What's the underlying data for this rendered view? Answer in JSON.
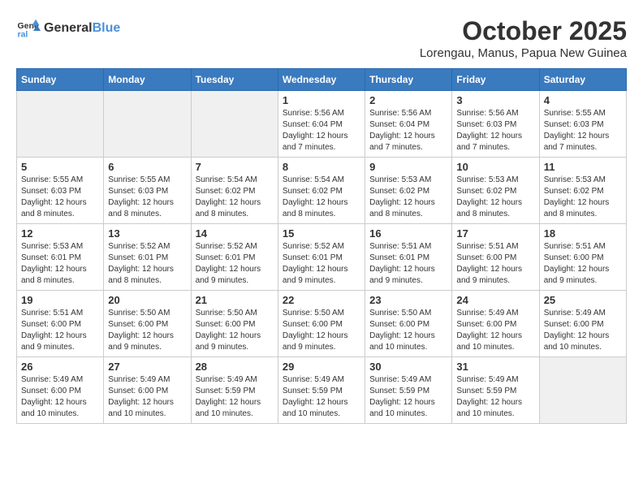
{
  "header": {
    "logo_line1": "General",
    "logo_line2": "Blue",
    "month_title": "October 2025",
    "subtitle": "Lorengau, Manus, Papua New Guinea"
  },
  "days_of_week": [
    "Sunday",
    "Monday",
    "Tuesday",
    "Wednesday",
    "Thursday",
    "Friday",
    "Saturday"
  ],
  "weeks": [
    [
      {
        "day": "",
        "info": ""
      },
      {
        "day": "",
        "info": ""
      },
      {
        "day": "",
        "info": ""
      },
      {
        "day": "1",
        "info": "Sunrise: 5:56 AM\nSunset: 6:04 PM\nDaylight: 12 hours and 7 minutes."
      },
      {
        "day": "2",
        "info": "Sunrise: 5:56 AM\nSunset: 6:04 PM\nDaylight: 12 hours and 7 minutes."
      },
      {
        "day": "3",
        "info": "Sunrise: 5:56 AM\nSunset: 6:03 PM\nDaylight: 12 hours and 7 minutes."
      },
      {
        "day": "4",
        "info": "Sunrise: 5:55 AM\nSunset: 6:03 PM\nDaylight: 12 hours and 7 minutes."
      }
    ],
    [
      {
        "day": "5",
        "info": "Sunrise: 5:55 AM\nSunset: 6:03 PM\nDaylight: 12 hours and 8 minutes."
      },
      {
        "day": "6",
        "info": "Sunrise: 5:55 AM\nSunset: 6:03 PM\nDaylight: 12 hours and 8 minutes."
      },
      {
        "day": "7",
        "info": "Sunrise: 5:54 AM\nSunset: 6:02 PM\nDaylight: 12 hours and 8 minutes."
      },
      {
        "day": "8",
        "info": "Sunrise: 5:54 AM\nSunset: 6:02 PM\nDaylight: 12 hours and 8 minutes."
      },
      {
        "day": "9",
        "info": "Sunrise: 5:53 AM\nSunset: 6:02 PM\nDaylight: 12 hours and 8 minutes."
      },
      {
        "day": "10",
        "info": "Sunrise: 5:53 AM\nSunset: 6:02 PM\nDaylight: 12 hours and 8 minutes."
      },
      {
        "day": "11",
        "info": "Sunrise: 5:53 AM\nSunset: 6:02 PM\nDaylight: 12 hours and 8 minutes."
      }
    ],
    [
      {
        "day": "12",
        "info": "Sunrise: 5:53 AM\nSunset: 6:01 PM\nDaylight: 12 hours and 8 minutes."
      },
      {
        "day": "13",
        "info": "Sunrise: 5:52 AM\nSunset: 6:01 PM\nDaylight: 12 hours and 8 minutes."
      },
      {
        "day": "14",
        "info": "Sunrise: 5:52 AM\nSunset: 6:01 PM\nDaylight: 12 hours and 9 minutes."
      },
      {
        "day": "15",
        "info": "Sunrise: 5:52 AM\nSunset: 6:01 PM\nDaylight: 12 hours and 9 minutes."
      },
      {
        "day": "16",
        "info": "Sunrise: 5:51 AM\nSunset: 6:01 PM\nDaylight: 12 hours and 9 minutes."
      },
      {
        "day": "17",
        "info": "Sunrise: 5:51 AM\nSunset: 6:00 PM\nDaylight: 12 hours and 9 minutes."
      },
      {
        "day": "18",
        "info": "Sunrise: 5:51 AM\nSunset: 6:00 PM\nDaylight: 12 hours and 9 minutes."
      }
    ],
    [
      {
        "day": "19",
        "info": "Sunrise: 5:51 AM\nSunset: 6:00 PM\nDaylight: 12 hours and 9 minutes."
      },
      {
        "day": "20",
        "info": "Sunrise: 5:50 AM\nSunset: 6:00 PM\nDaylight: 12 hours and 9 minutes."
      },
      {
        "day": "21",
        "info": "Sunrise: 5:50 AM\nSunset: 6:00 PM\nDaylight: 12 hours and 9 minutes."
      },
      {
        "day": "22",
        "info": "Sunrise: 5:50 AM\nSunset: 6:00 PM\nDaylight: 12 hours and 9 minutes."
      },
      {
        "day": "23",
        "info": "Sunrise: 5:50 AM\nSunset: 6:00 PM\nDaylight: 12 hours and 10 minutes."
      },
      {
        "day": "24",
        "info": "Sunrise: 5:49 AM\nSunset: 6:00 PM\nDaylight: 12 hours and 10 minutes."
      },
      {
        "day": "25",
        "info": "Sunrise: 5:49 AM\nSunset: 6:00 PM\nDaylight: 12 hours and 10 minutes."
      }
    ],
    [
      {
        "day": "26",
        "info": "Sunrise: 5:49 AM\nSunset: 6:00 PM\nDaylight: 12 hours and 10 minutes."
      },
      {
        "day": "27",
        "info": "Sunrise: 5:49 AM\nSunset: 6:00 PM\nDaylight: 12 hours and 10 minutes."
      },
      {
        "day": "28",
        "info": "Sunrise: 5:49 AM\nSunset: 5:59 PM\nDaylight: 12 hours and 10 minutes."
      },
      {
        "day": "29",
        "info": "Sunrise: 5:49 AM\nSunset: 5:59 PM\nDaylight: 12 hours and 10 minutes."
      },
      {
        "day": "30",
        "info": "Sunrise: 5:49 AM\nSunset: 5:59 PM\nDaylight: 12 hours and 10 minutes."
      },
      {
        "day": "31",
        "info": "Sunrise: 5:49 AM\nSunset: 5:59 PM\nDaylight: 12 hours and 10 minutes."
      },
      {
        "day": "",
        "info": ""
      }
    ]
  ]
}
